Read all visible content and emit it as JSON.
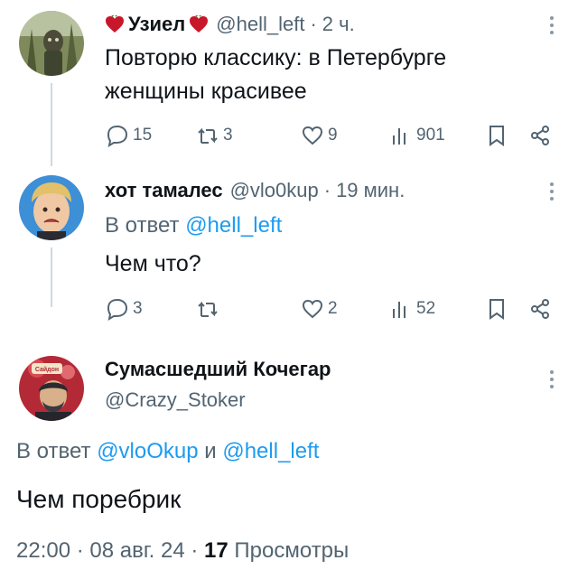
{
  "colors": {
    "link": "#1d9bf0",
    "secondary": "#536471",
    "text": "#0f1419",
    "line": "#cfd9de",
    "heart": "#c8162a"
  },
  "tweet1": {
    "display_name": "Узиел",
    "handle": "@hell_left",
    "dot": "·",
    "time": "2 ч.",
    "text": "Повторю классику: в Петербурге женщины красивее",
    "stats": {
      "replies": "15",
      "retweets": "3",
      "likes": "9",
      "views": "901"
    }
  },
  "tweet2": {
    "display_name": "хот тамалес",
    "handle": "@vlo0kup",
    "dot": "·",
    "time": "19 мин.",
    "reply_prefix": "В ответ",
    "reply_handle": "@hell_left",
    "text": "Чем что?",
    "stats": {
      "replies": "3",
      "retweets": "",
      "likes": "2",
      "views": "52"
    }
  },
  "tweet3": {
    "display_name": "Сумасшедший Кочегар",
    "handle": "@Crazy_Stoker",
    "reply_prefix": "В ответ",
    "reply_handle1": "@vloOkup",
    "reply_and": "и",
    "reply_handle2": "@hell_left",
    "text": "Чем поребрик",
    "timestamp": "22:00 · 08 авг. 24 ·",
    "views_count": "17",
    "views_label": "Просмотры",
    "avatar_badge": "Сайдон"
  },
  "icons": [
    "heart-icon",
    "reply-icon",
    "retweet-icon",
    "like-icon",
    "views-icon",
    "bookmark-icon",
    "share-icon",
    "more-icon"
  ]
}
